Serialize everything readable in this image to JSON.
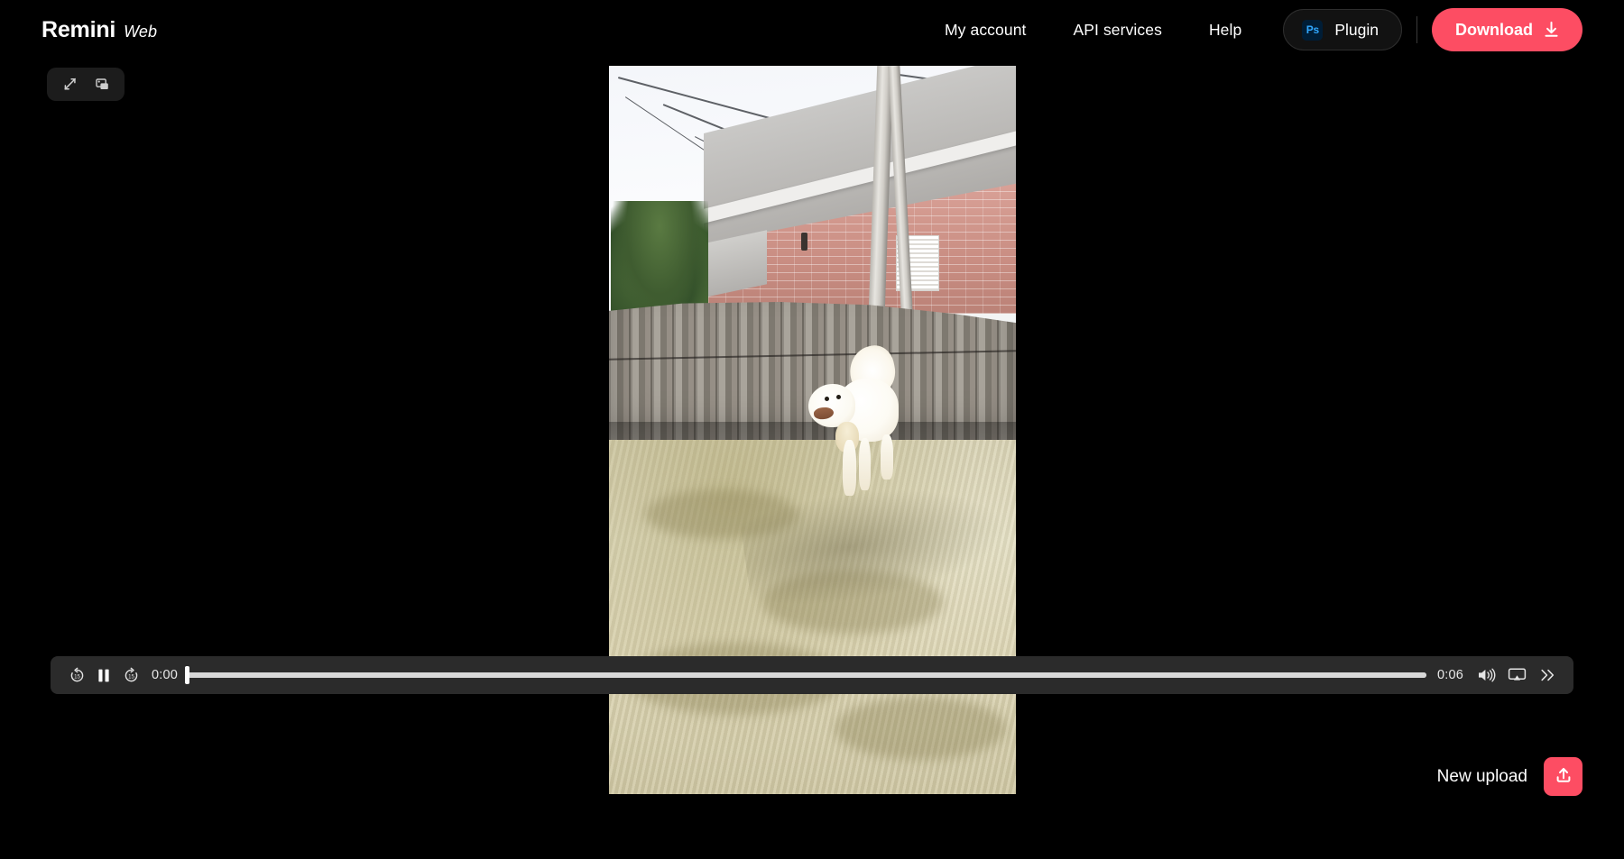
{
  "header": {
    "brand_name": "Remini",
    "brand_sub": "Web",
    "nav": [
      {
        "label": "My account",
        "name": "nav-my-account"
      },
      {
        "label": "API services",
        "name": "nav-api-services"
      },
      {
        "label": "Help",
        "name": "nav-help"
      }
    ],
    "plugin": {
      "badge": "Ps",
      "label": "Plugin",
      "badge_bg": "#001d36",
      "badge_fg": "#31a8ff"
    },
    "download": {
      "label": "Download",
      "icon": "download-icon",
      "color": "#fd4d63"
    }
  },
  "toolbar": {
    "compare_icon": "diagonal-compare-arrow-icon",
    "layers_icon": "image-layers-icon"
  },
  "player": {
    "rewind_icon": "rewind-15-icon",
    "rewind_label": "15",
    "pause_icon": "pause-icon",
    "forward_icon": "forward-15-icon",
    "forward_label": "15",
    "current_time": "0:00",
    "duration": "0:06",
    "progress_percent": 0,
    "buffered_percent": 100,
    "volume_icon": "volume-high-icon",
    "airplay_icon": "airplay-icon",
    "more_icon": "double-chevron-right-icon"
  },
  "footer": {
    "new_upload_label": "New upload",
    "upload_icon": "upload-icon",
    "upload_color": "#fd4d63"
  },
  "media": {
    "type": "video",
    "description": "White standard poodle standing on a dry winter lawn in a fenced backyard with a brick house and bare birch trees behind the wooden fence"
  },
  "theme": {
    "background": "#000000",
    "accent": "#fd4d63",
    "control_bar": "#2b2b2b",
    "text": "#ffffff"
  }
}
